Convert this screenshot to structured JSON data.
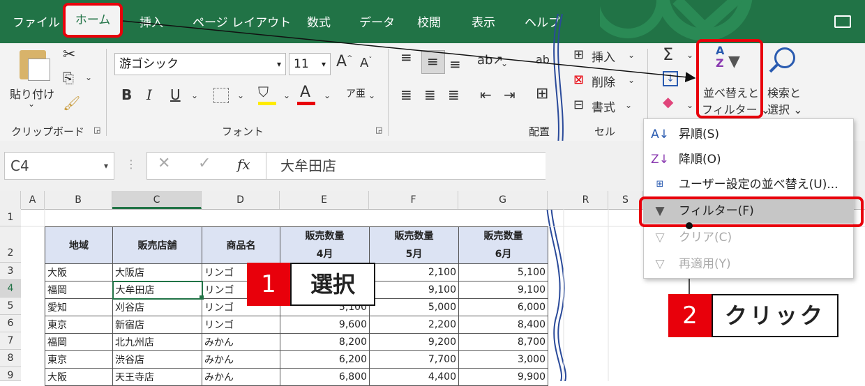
{
  "menu": {
    "tabs": [
      "ファイル",
      "ホーム",
      "挿入",
      "ページ レイアウト",
      "数式",
      "データ",
      "校閲",
      "表示",
      "ヘルプ"
    ]
  },
  "ribbon": {
    "clipboard": {
      "paste_label": "貼り付け",
      "group_label": "クリップボード"
    },
    "font": {
      "font_name": "游ゴシック",
      "font_size": "11",
      "bold": "B",
      "italic": "I",
      "underline": "U",
      "group_label": "フォント"
    },
    "alignment": {
      "group_label": "配置"
    },
    "cells": {
      "insert_label": "挿入",
      "delete_label": "削除",
      "format_label": "書式",
      "group_label": "セル"
    },
    "editing": {
      "sigma": "Σ",
      "sort_filter_label_1": "並べ替えと",
      "sort_filter_label_2": "フィルター",
      "find_label_1": "検索と",
      "find_label_2": "選択"
    }
  },
  "formula_bar": {
    "name_box": "C4",
    "fx": "fx",
    "value": "大牟田店"
  },
  "columns": [
    "A",
    "B",
    "C",
    "D",
    "E",
    "F",
    "G",
    "R",
    "S"
  ],
  "rows": [
    "1",
    "2",
    "3",
    "4",
    "5",
    "6",
    "7",
    "8",
    "9"
  ],
  "table": {
    "headers": [
      "地域",
      "販売店舗",
      "商品名"
    ],
    "qty_headers": [
      {
        "top": "販売数量",
        "bottom": "4月"
      },
      {
        "top": "販売数量",
        "bottom": "5月"
      },
      {
        "top": "販売数量",
        "bottom": "6月"
      }
    ],
    "rows": [
      [
        "大阪",
        "大阪店",
        "リンゴ",
        "",
        "2,100",
        "5,100"
      ],
      [
        "福岡",
        "大牟田店",
        "リンゴ",
        "",
        "9,100",
        "9,100"
      ],
      [
        "愛知",
        "刈谷店",
        "リンゴ",
        "5,100",
        "5,000",
        "6,000"
      ],
      [
        "東京",
        "新宿店",
        "リンゴ",
        "9,600",
        "2,200",
        "8,400"
      ],
      [
        "福岡",
        "北九州店",
        "みかん",
        "8,200",
        "9,200",
        "8,700"
      ],
      [
        "東京",
        "渋谷店",
        "みかん",
        "6,200",
        "7,700",
        "3,000"
      ],
      [
        "大阪",
        "天王寺店",
        "みかん",
        "6,800",
        "4,400",
        "9,900"
      ]
    ]
  },
  "dropdown": {
    "items": [
      {
        "label": "昇順(S)",
        "icon": "sort-asc-icon",
        "enabled": true
      },
      {
        "label": "降順(O)",
        "icon": "sort-desc-icon",
        "enabled": true
      },
      {
        "label": "ユーザー設定の並べ替え(U)...",
        "icon": "custom-sort-icon",
        "enabled": true
      },
      {
        "label": "フィルター(F)",
        "icon": "filter-icon",
        "enabled": true
      },
      {
        "label": "クリア(C)",
        "icon": "clear-filter-icon",
        "enabled": false
      },
      {
        "label": "再適用(Y)",
        "icon": "reapply-icon",
        "enabled": false
      }
    ]
  },
  "callouts": {
    "step1": {
      "num": "1",
      "text": "選択"
    },
    "step2": {
      "num": "2",
      "text": "クリック"
    }
  },
  "colors": {
    "excel_green": "#217346",
    "accent_red": "#e8000b",
    "header_blue": "#dce3f3"
  }
}
